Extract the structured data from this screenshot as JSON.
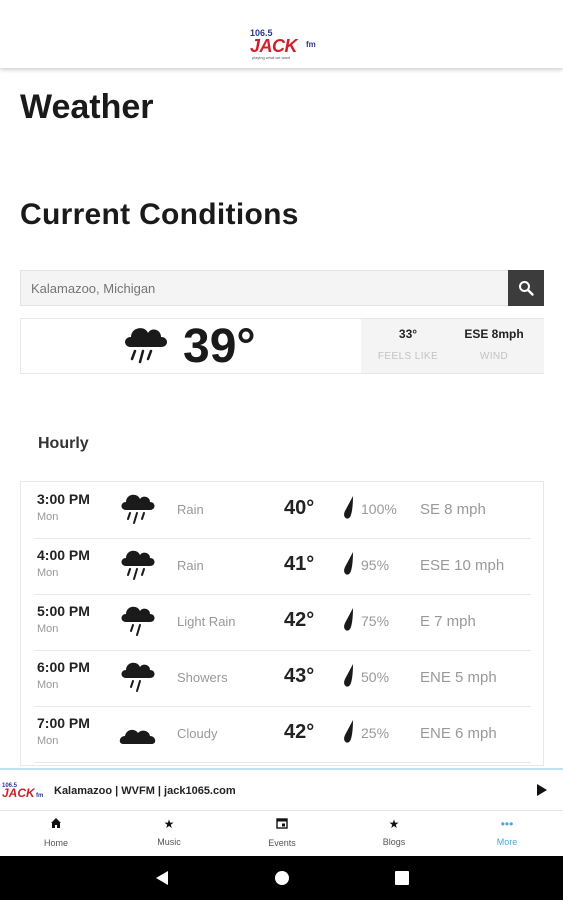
{
  "header": {
    "logo": {
      "number": "106.5",
      "name": "JACK",
      "suffix": "fm",
      "tagline": "playing what we want"
    }
  },
  "page": {
    "title": "Weather",
    "section_title": "Current Conditions"
  },
  "search": {
    "placeholder": "Kalamazoo, Michigan"
  },
  "current": {
    "icon": "rain-cloud-icon",
    "temperature": "39°",
    "feels_like_value": "33°",
    "feels_like_label": "FEELS LIKE",
    "wind_value": "ESE 8mph",
    "wind_label": "WIND"
  },
  "hourly": {
    "label": "Hourly",
    "rows": [
      {
        "time": "3:00 PM",
        "day": "Mon",
        "icon": "heavy-rain-icon",
        "condition": "Rain",
        "temp": "40°",
        "precip": "100%",
        "wind": "SE 8 mph"
      },
      {
        "time": "4:00 PM",
        "day": "Mon",
        "icon": "heavy-rain-icon",
        "condition": "Rain",
        "temp": "41°",
        "precip": "95%",
        "wind": "ESE 10 mph"
      },
      {
        "time": "5:00 PM",
        "day": "Mon",
        "icon": "light-rain-icon",
        "condition": "Light Rain",
        "temp": "42°",
        "precip": "75%",
        "wind": "E 7 mph"
      },
      {
        "time": "6:00 PM",
        "day": "Mon",
        "icon": "showers-icon",
        "condition": "Showers",
        "temp": "43°",
        "precip": "50%",
        "wind": "ENE 5 mph"
      },
      {
        "time": "7:00 PM",
        "day": "Mon",
        "icon": "cloudy-icon",
        "condition": "Cloudy",
        "temp": "42°",
        "precip": "25%",
        "wind": "ENE 6 mph"
      }
    ]
  },
  "player": {
    "info": "Kalamazoo | WVFM | jack1065.com"
  },
  "nav": {
    "items": [
      {
        "label": "Home",
        "icon": "home-icon"
      },
      {
        "label": "Music",
        "icon": "star-icon"
      },
      {
        "label": "Events",
        "icon": "calendar-icon"
      },
      {
        "label": "Blogs",
        "icon": "star-icon"
      },
      {
        "label": "More",
        "icon": "more-dots-icon"
      }
    ],
    "active": "More",
    "accent_color": "#4aa8d8"
  }
}
